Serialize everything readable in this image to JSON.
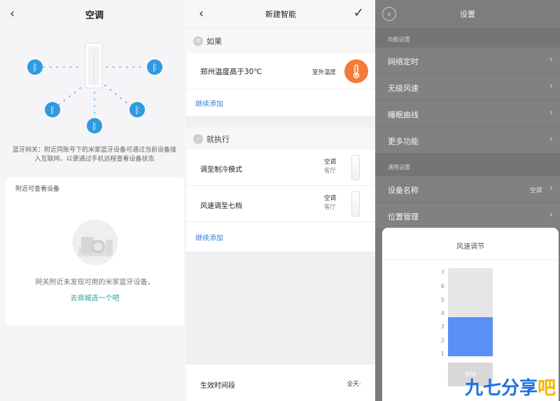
{
  "panel1": {
    "title": "空调",
    "description": "蓝牙网关：附近同账号下的米家蓝牙设备可通过当前设备接入互联网，以便通过手机远程查看设备状态",
    "nearby_title": "附近可查看设备",
    "empty_text": "网关附近未发现可用的米家蓝牙设备，",
    "shop_link": "去商城选一个吧"
  },
  "panel2": {
    "title": "新建智能",
    "if_label": "如果",
    "condition": {
      "label": "郑州温度高于30℃",
      "source": "室外温度"
    },
    "add_more": "继续添加",
    "then_label": "就执行",
    "actions": [
      {
        "label": "调至制冷模式",
        "device": "空调",
        "room": "客厅"
      },
      {
        "label": "风速调至七档",
        "device": "空调",
        "room": "客厅"
      }
    ],
    "add_more_2": "继续添加",
    "active_time_label": "生效时间段",
    "active_time_value": "全天"
  },
  "panel3": {
    "title": "设置",
    "group1_label": "功能设置",
    "items1": [
      {
        "label": "网络定时"
      },
      {
        "label": "无级风速"
      },
      {
        "label": "睡眠曲线"
      },
      {
        "label": "更多功能"
      }
    ],
    "group2_label": "通用设置",
    "items2": [
      {
        "label": "设备名称",
        "value": "空调"
      },
      {
        "label": "位置管理"
      }
    ],
    "modal": {
      "title": "风速调节",
      "ticks": [
        "7",
        "6",
        "5",
        "4",
        "3",
        "2",
        "1"
      ],
      "level": 3,
      "max_level": 7,
      "auto_label": "自动"
    }
  },
  "watermark": {
    "text": "九七分享",
    "tail": "吧"
  },
  "colors": {
    "accent_blue": "#5b8ff6",
    "bluetooth": "#2f9ae0",
    "orange": "#f47b3a",
    "link_teal": "#2a9d9e",
    "link_blue": "#3a7dd4"
  },
  "icons": [
    "back-arrow-icon",
    "bluetooth-icon",
    "check-icon",
    "list-icon",
    "arrow-right-circle-icon",
    "thermometer-icon",
    "chevron-right-icon"
  ]
}
